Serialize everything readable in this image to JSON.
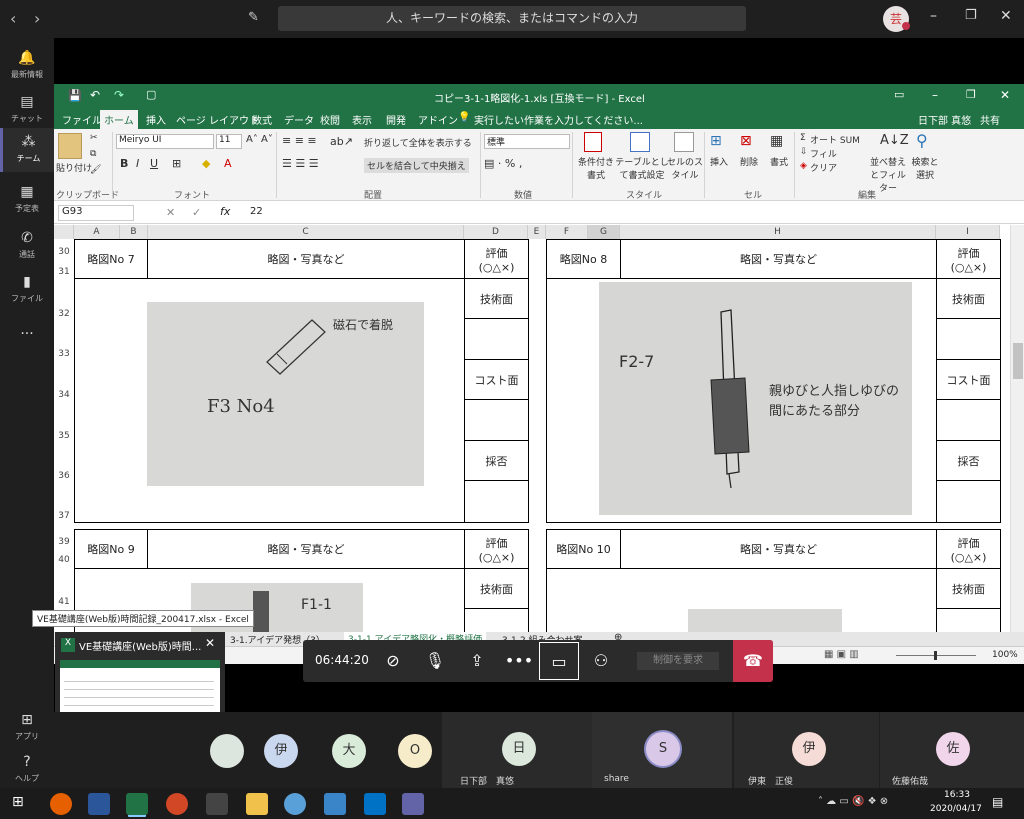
{
  "teams": {
    "search_placeholder": "人、キーワードの検索、またはコマンドの入力",
    "avatar_initials": "芸"
  },
  "rail": [
    {
      "icon": "bell-icon",
      "label": "最新情報"
    },
    {
      "icon": "chat-icon",
      "label": "チャット"
    },
    {
      "icon": "teams-icon",
      "label": "チーム"
    },
    {
      "icon": "calendar-icon",
      "label": "予定表"
    },
    {
      "icon": "phone-icon",
      "label": "通話"
    },
    {
      "icon": "file-icon",
      "label": "ファイル"
    },
    {
      "icon": "more-icon",
      "label": "..."
    },
    {
      "icon": "apps-icon",
      "label": "アプリ"
    },
    {
      "icon": "help-icon",
      "label": "ヘルプ"
    }
  ],
  "excel": {
    "title": "コピー3-1-1略図化-1.xls [互換モード] - Excel",
    "tabs": [
      "ファイル",
      "ホーム",
      "挿入",
      "ページ レイアウト",
      "数式",
      "データ",
      "校閲",
      "表示",
      "開発",
      "アドイン"
    ],
    "active_tab": "ホーム",
    "tell_me": "実行したい作業を入力してください...",
    "user": "日下部 真悠",
    "share": "共有",
    "ribbon": {
      "paste": "貼り付け",
      "clipboard": "クリップボード",
      "font_name": "Meiryo UI",
      "font_size": "11",
      "font_group": "フォント",
      "wrap": "折り返して全体を表示する",
      "merge": "セルを結合して中央揃え",
      "align_group": "配置",
      "num_format": "標準",
      "num_group": "数値",
      "cond": "条件付き書式",
      "table": "テーブルとして書式設定",
      "cellstyle": "セルのスタイル",
      "style_group": "スタイル",
      "insert": "挿入",
      "delete": "削除",
      "format": "書式",
      "cell_group": "セル",
      "autosum": "オート SUM",
      "fill": "フィル",
      "clear": "クリア",
      "sort": "並べ替えとフィルター",
      "find": "検索と選択",
      "edit_group": "編集"
    },
    "name_box": "G93",
    "formula": "22",
    "cols": [
      "A",
      "B",
      "C",
      "D",
      "E",
      "F",
      "G",
      "H",
      "I"
    ],
    "rows_top": [
      "30",
      "31",
      "32",
      "33",
      "34",
      "35",
      "36",
      "37"
    ],
    "rows_bottom": [
      "39",
      "40",
      "41"
    ],
    "sk_label": "略図No",
    "sk_no": [
      "7",
      "8",
      "9",
      "10"
    ],
    "photo_label": "略図・写真など",
    "eval": "評価",
    "eval_sym": "(○△×)",
    "eval_rows": [
      "技術面",
      "コスト面",
      "採否"
    ],
    "sheet_tabs": [
      "3-1.アイデア発想（3）",
      "3-1-1.アイデア略図化・概略評価",
      "3-1-2.組み合わせ案..."
    ],
    "zoom": "100%",
    "tooltip": "VE基礎講座(Web版)時間記録_200417.xlsx - Excel",
    "sketch_texts": [
      "F3  No4",
      "磁石で着脱",
      "F2-7",
      "親ゆびと人指しゆびの間にあたる部分",
      "F1-1"
    ]
  },
  "call": {
    "time": "06:44:20",
    "request_control": "制御を要求"
  },
  "preview_title": "VE基礎講座(Web版)時間...",
  "participants": [
    {
      "initial": "伊",
      "name": "",
      "color": "#c9d7ef"
    },
    {
      "initial": "大",
      "name": "",
      "color": "#d9ecd9"
    },
    {
      "initial": "O",
      "name": "",
      "color": "#f6ecc9"
    },
    {
      "initial": "日",
      "name": "日下部　真悠",
      "color": "#dbe8db"
    },
    {
      "initial": "S",
      "name": "share",
      "color": "#d9c8e8"
    },
    {
      "initial": "伊",
      "name": "伊東　正俊",
      "color": "#f6dcd6"
    },
    {
      "initial": "佐",
      "name": "佐藤佑哉",
      "color": "#f1d5ea"
    }
  ],
  "clock": {
    "time": "16:33",
    "date": "2020/04/17"
  }
}
